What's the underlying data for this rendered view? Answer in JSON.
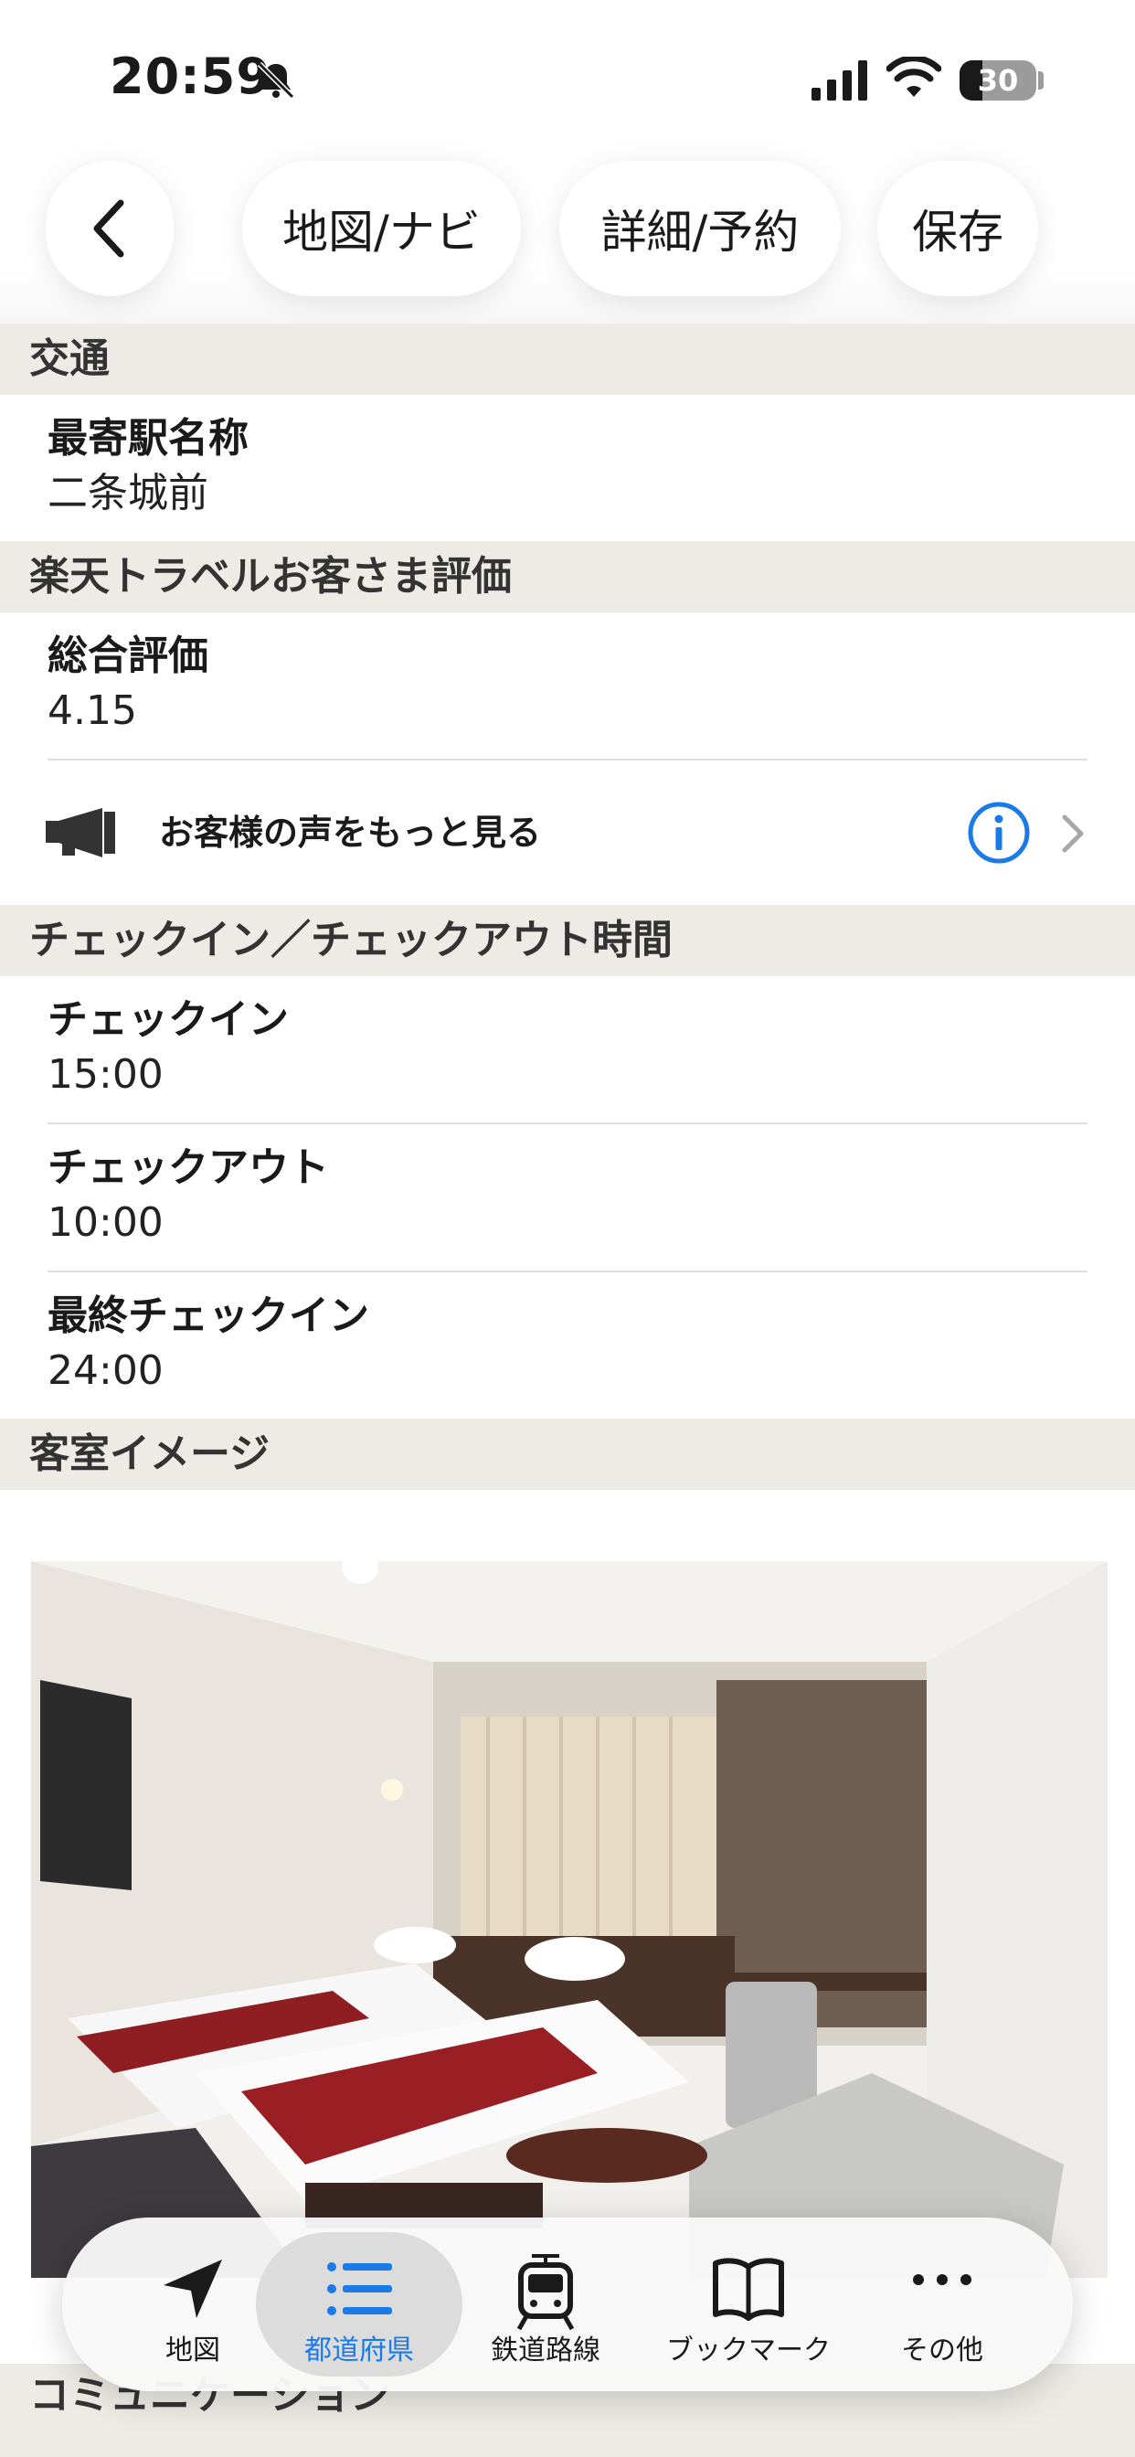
{
  "status_bar": {
    "time": "20:59",
    "battery_percent": "30",
    "battery_level": 0.3,
    "icons": [
      "bell-slash-icon",
      "signal-icon",
      "wifi-icon",
      "battery-icon"
    ]
  },
  "topbar": {
    "back_icon": "chevron-left-icon",
    "map_label": "地図/ナビ",
    "detail_label": "詳細/予約",
    "save_label": "保存"
  },
  "sections": {
    "transport": {
      "header": "交通",
      "station_label": "最寄駅名称",
      "station_value": "二条城前"
    },
    "rating": {
      "header": "楽天トラベルお客さま評価",
      "overall_label": "総合評価",
      "overall_value": "4.15",
      "voices_link": "お客様の声をもっと見る",
      "icons": [
        "megaphone-icon",
        "info-icon",
        "chevron-right-icon"
      ]
    },
    "checkin": {
      "header": "チェックイン／チェックアウト時間",
      "checkin_label": "チェックイン",
      "checkin_value": "15:00",
      "checkout_label": "チェックアウト",
      "checkout_value": "10:00",
      "last_checkin_label": "最終チェックイン",
      "last_checkin_value": "24:00"
    },
    "room_image": {
      "header": "客室イメージ"
    },
    "communication": {
      "header": "コミュニケーション"
    }
  },
  "tabbar": {
    "accent_color": "#1a7ae8",
    "items": [
      {
        "label": "地図",
        "icon": "location-arrow-icon"
      },
      {
        "label": "都道府県",
        "icon": "list-icon"
      },
      {
        "label": "鉄道路線",
        "icon": "train-icon"
      },
      {
        "label": "ブックマーク",
        "icon": "book-icon"
      },
      {
        "label": "その他",
        "icon": "more-icon"
      }
    ]
  }
}
